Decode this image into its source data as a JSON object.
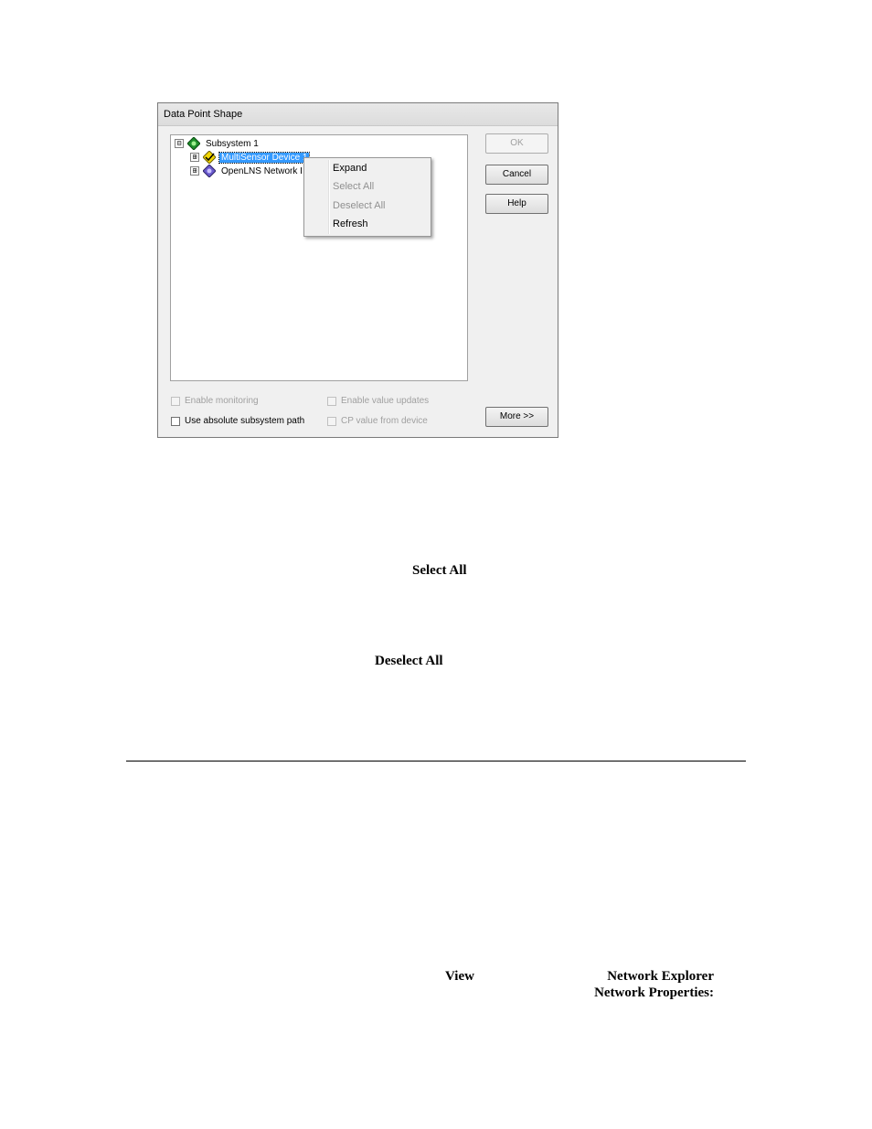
{
  "dialog": {
    "title": "Data Point Shape",
    "tree": {
      "root": {
        "expander": "⊟",
        "label": "Subsystem 1",
        "icon": "green-diamond-icon"
      },
      "children": [
        {
          "expander": "⊞",
          "label": "MultiSensor Device 1",
          "icon": "yellow-diamond-check-icon",
          "selected": true
        },
        {
          "expander": "⊞",
          "label": "OpenLNS Network I",
          "icon": "purple-diamond-icon"
        }
      ]
    },
    "buttons": {
      "ok": "OK",
      "cancel": "Cancel",
      "help": "Help",
      "more": "More >>"
    },
    "checkboxes": {
      "enable_monitoring": "Enable monitoring",
      "enable_value_updates": "Enable value updates",
      "use_absolute_path": "Use absolute subsystem path",
      "cp_value_from_device": "CP value from device"
    }
  },
  "context_menu": {
    "items": [
      {
        "label": "Expand",
        "enabled": true
      },
      {
        "label": "Select All",
        "enabled": false
      },
      {
        "label": "Deselect All",
        "enabled": false
      },
      {
        "label": "Refresh",
        "enabled": true
      }
    ]
  },
  "document": {
    "select_all": "Select All",
    "deselect_all": "Deselect All",
    "view": "View",
    "network_explorer": "Network Explorer",
    "network_properties": "Network Properties:"
  },
  "colors": {
    "selection": "#3399ff",
    "dialog_bg": "#f0f0f0"
  }
}
